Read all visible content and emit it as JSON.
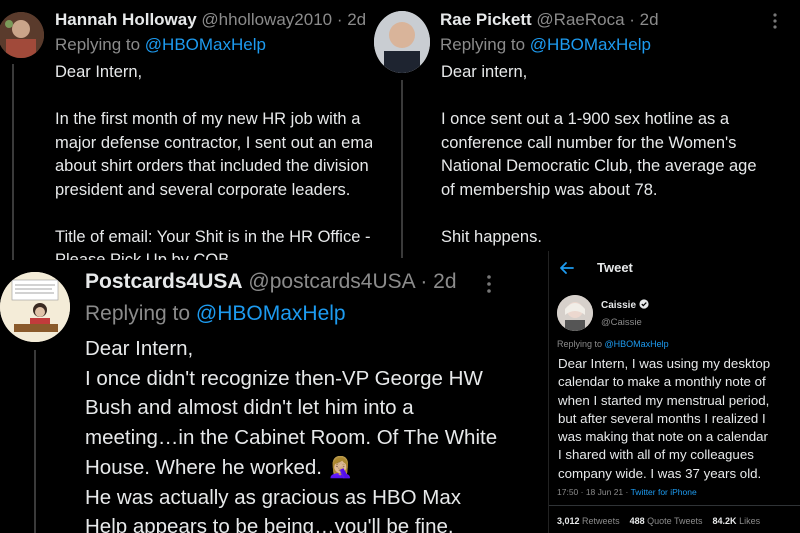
{
  "tweets": {
    "hannah": {
      "name": "Hannah Holloway",
      "handle": "@hholloway2010",
      "time": "· 2d",
      "replying_prefix": "Replying to ",
      "replying_to": "@HBOMaxHelp",
      "lines": [
        "Dear Intern,",
        "",
        "In the first month of my new HR job with a",
        "major defense contractor, I sent out an ema",
        "about shirt orders that included the division",
        "president and several corporate leaders.",
        "",
        "Title of email: Your Shit is in the HR Office -",
        "Please Pick Up by COB"
      ]
    },
    "rae": {
      "name": "Rae Pickett",
      "handle": "@RaeRoca",
      "time": "· 2d",
      "replying_prefix": "Replying to ",
      "replying_to": "@HBOMaxHelp",
      "lines": [
        "Dear intern,",
        "",
        "I once sent out a 1-900 sex hotline as a",
        "conference call number for the Women's",
        "National Democratic Club, the average age",
        "of membership was about 78.",
        "",
        "Shit happens."
      ]
    },
    "postcards": {
      "name": "Postcards4USA",
      "handle": "@postcards4USA",
      "time": "· 2d",
      "replying_prefix": "Replying to ",
      "replying_to": "@HBOMaxHelp",
      "lines": [
        "Dear Intern,",
        "I once didn't recognize then-VP George HW",
        "Bush and almost didn't let him into a",
        "meeting…in the Cabinet Room. Of The White",
        "House. Where he worked. 🤦🏼‍♀️",
        "He was actually as gracious as HBO Max",
        "Help appears to be being…you'll be fine."
      ]
    },
    "caissie": {
      "screen_title": "Tweet",
      "name": "Caissie",
      "handle": "@Caissie",
      "replying_prefix": "Replying to ",
      "replying_to": "@HBOMaxHelp",
      "lines": [
        "Dear Intern, I was using my desktop",
        "calendar to make a monthly note of",
        "when I started my menstrual period,",
        "but after several months I realized I",
        "was making that note on a calendar",
        "I shared with all of my colleagues",
        "company wide. I was 37 years old."
      ],
      "timestamp": "17:50 · 18 Jun 21 ·",
      "client": "Twitter for iPhone",
      "retweets_count": "3,012",
      "retweets_label": "Retweets",
      "quotes_count": "488",
      "quotes_label": "Quote Tweets",
      "likes_count": "84.2K",
      "likes_label": "Likes"
    }
  },
  "icons": {
    "more": "more-vertical-icon",
    "back": "arrow-left-icon",
    "verified": "verified-badge-icon"
  },
  "colors": {
    "background": "#000000",
    "text": "#e7e9ea",
    "secondary": "#8b8b8b",
    "link": "#1d9bf0",
    "divider": "#2f3336"
  }
}
